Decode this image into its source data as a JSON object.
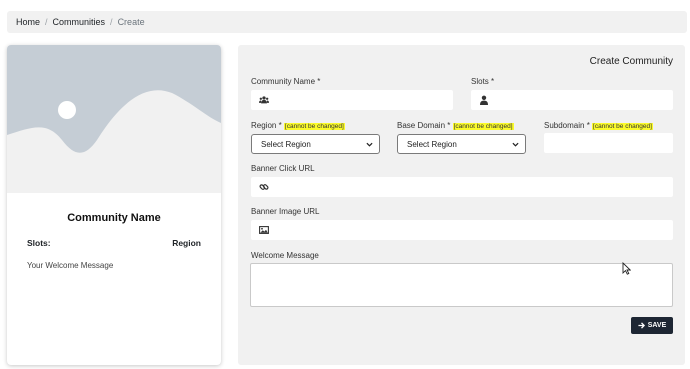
{
  "breadcrumb": {
    "home": "Home",
    "sep": "/",
    "communities": "Communities",
    "current": "Create"
  },
  "preview": {
    "community_name": "Community Name",
    "slots_label": "Slots:",
    "region_label": "Region",
    "welcome_message": "Your Welcome Message"
  },
  "form": {
    "title": "Create Community",
    "community_name_label": "Community Name *",
    "slots_label": "Slots *",
    "region_label": "Region *",
    "base_domain_label": "Base Domain *",
    "subdomain_label": "Subdomain *",
    "cannot_change": "[cannot be changed]",
    "region_select_value": "Select Region",
    "base_domain_select_value": "Select Region",
    "banner_click_url_label": "Banner Click URL",
    "banner_image_url_label": "Banner Image URL",
    "welcome_message_label": "Welcome Message",
    "save_label": "SAVE"
  },
  "colors": {
    "panel_bg": "#f1f1f1",
    "highlight": "#fbfb2a",
    "button_bg": "#1d2633",
    "placeholder_image": "#c5cdd5"
  },
  "icons": {
    "community_name": "users-icon",
    "slots": "user-icon",
    "banner_click": "link-icon",
    "banner_image": "image-icon",
    "save": "arrow-right-icon"
  }
}
